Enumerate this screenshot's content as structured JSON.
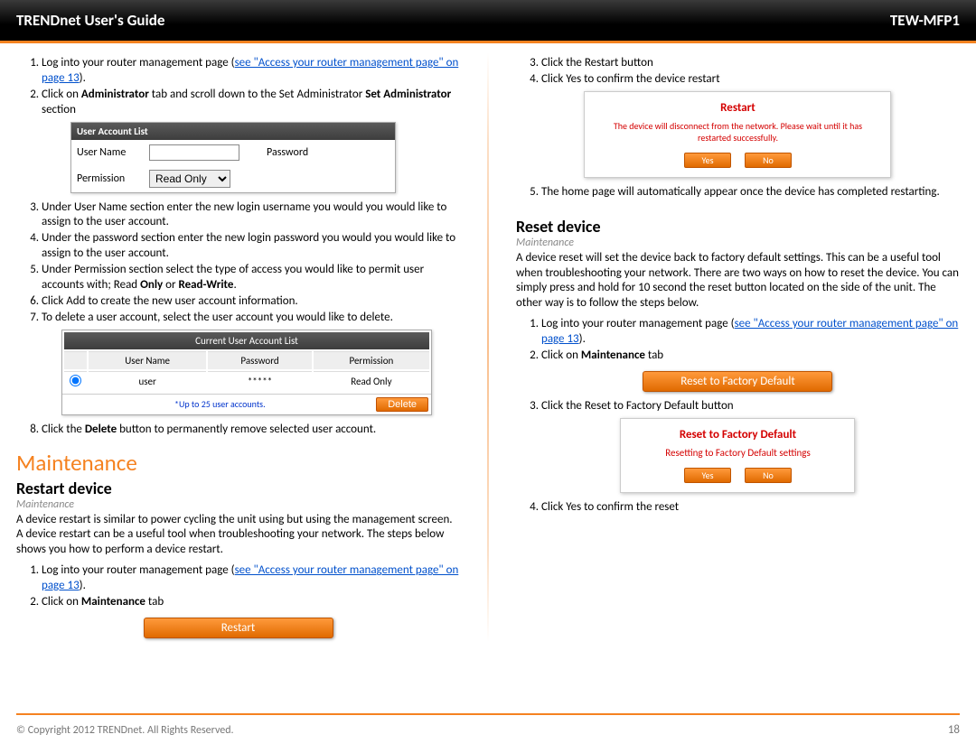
{
  "header": {
    "guide": "TRENDnet User's Guide",
    "model": "TEW-MFP1"
  },
  "left": {
    "steps_a": {
      "s1_pre": "Log into your router management page (",
      "s1_link": "see \"Access your router management page\" on page 13",
      "s1_post": ").",
      "s2_pre": "Click on ",
      "s2_b1": "Administrator",
      "s2_mid": " tab and scroll down to the Set Administrator ",
      "s2_b2": "Set Administrator",
      "s2_post": " section"
    },
    "panel1": {
      "title": "User Account List",
      "lbl_user": "User Name",
      "lbl_pass": "Password",
      "lbl_perm": "Permission",
      "perm_value": "Read Only"
    },
    "steps_b": {
      "s3": "Under User Name section enter the new login username you would you would like to assign to the user account.",
      "s4": "Under the password section enter the new login password you would you would like to assign to the user account.",
      "s5_pre": "Under Permission section select the type of access you would like to permit user accounts with; Read ",
      "s5_b1": "Only",
      "s5_mid": " or ",
      "s5_b2": "Read-Write",
      "s5_post": ".",
      "s6": "Click Add to create the new user account information.",
      "s7": "To delete a user account, select the user account you would like to delete."
    },
    "panel2": {
      "title": "Current User Account List",
      "h_user": "User Name",
      "h_pass": "Password",
      "h_perm": "Permission",
      "row_user": "user",
      "row_pass": "*****",
      "row_perm": "Read Only",
      "footnote": "*Up to 25 user accounts.",
      "delete": "Delete"
    },
    "step8_pre": "Click the ",
    "step8_b": "Delete",
    "step8_post": " button to permanently remove selected user account.",
    "h1": "Maintenance",
    "h2": "Restart device",
    "crumb": "Maintenance",
    "para": "A device restart is similar to power cycling the unit using but using the management screen. A device restart can be a useful tool when troubleshooting your network.  The steps below shows you how to perform a device restart.",
    "steps_c": {
      "s1_pre": "Log into your router management page (",
      "s1_link": "see \"Access your router management page\" on page 13",
      "s1_post": ").",
      "s2_pre": "Click on ",
      "s2_b": "Maintenance",
      "s2_post": " tab"
    },
    "restart_btn": "Restart"
  },
  "right": {
    "steps_d": {
      "s3": "Click the Restart button",
      "s4": "Click Yes to confirm the device restart"
    },
    "dialog1": {
      "title": "Restart",
      "msg": "The device will disconnect from the network. Please wait until it has restarted successfully.",
      "yes": "Yes",
      "no": "No"
    },
    "step5": "The home page will automatically appear once the device has completed restarting.",
    "h2": "Reset device",
    "crumb": "Maintenance",
    "para": "A device reset will set the device back to factory default settings. This can be a useful tool when troubleshooting your network.  There are two ways on how to reset the device. You can simply press and hold for 10 second the reset button located on the side of the unit. The other way is to follow the steps below.",
    "steps_e": {
      "s1_pre": "Log into your router management page (",
      "s1_link": "see \"Access your router management page\" on page 13",
      "s1_post": ").",
      "s2_pre": "Click on ",
      "s2_b": "Maintenance",
      "s2_post": " tab"
    },
    "reset_btn": "Reset to Factory Default",
    "step3": "Click the Reset to Factory Default button",
    "dialog2": {
      "title": "Reset to Factory Default",
      "msg": "Resetting to Factory Default settings",
      "yes": "Yes",
      "no": "No"
    },
    "step4_final": "Click Yes to confirm the reset"
  },
  "footer": {
    "copyright": "© Copyright 2012 TRENDnet. All Rights Reserved.",
    "page": "18"
  }
}
